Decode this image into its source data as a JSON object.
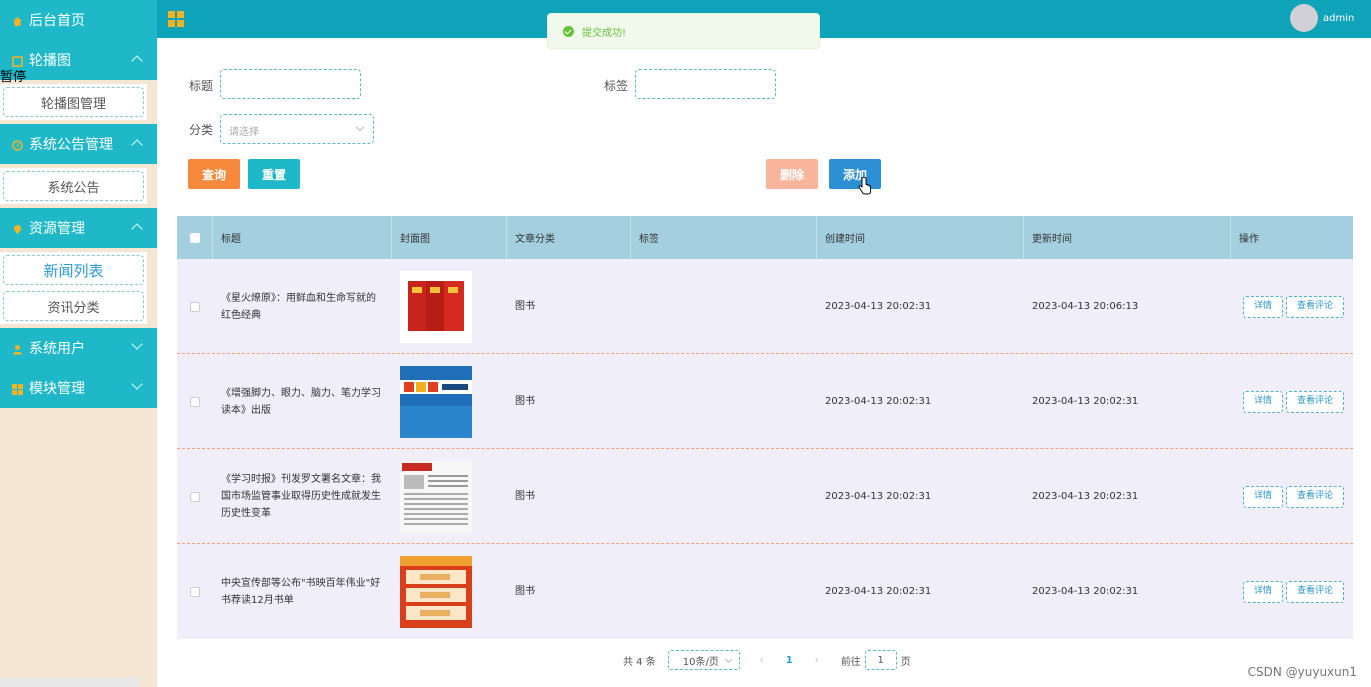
{
  "sidebar": {
    "home": "后台首页",
    "groups": [
      {
        "label": "轮播图",
        "items": [
          "轮播图管理"
        ]
      },
      {
        "label": "系统公告管理",
        "items": [
          "系统公告"
        ]
      },
      {
        "label": "资源管理",
        "items": [
          "新闻列表",
          "资讯分类"
        ]
      },
      {
        "label": "系统用户",
        "items": []
      },
      {
        "label": "模块管理",
        "items": []
      }
    ],
    "stray_text": "暂停",
    "accent": "#1fb8c9"
  },
  "topbar": {
    "user": "admin",
    "color": "#0fa3b9"
  },
  "toast": {
    "message": "提交成功!"
  },
  "search": {
    "title_label": "标题",
    "tag_label": "标签",
    "category_label": "分类",
    "category_placeholder": "请选择"
  },
  "buttons": {
    "query": "查询",
    "reset": "重置",
    "delete": "删除",
    "add": "添加"
  },
  "table": {
    "headers": [
      "标题",
      "封面图",
      "文章分类",
      "标签",
      "创建时间",
      "更新时间",
      "操作"
    ],
    "rows": [
      {
        "title": "《星火燎原》：用鲜血和生命写就的红色经典",
        "category": "图书",
        "tag": "",
        "created": "2023-04-13 20:02:31",
        "updated": "2023-04-13 20:06:13"
      },
      {
        "title": "《增强脚力、眼力、脑力、笔力学习读本》出版",
        "category": "图书",
        "tag": "",
        "created": "2023-04-13 20:02:31",
        "updated": "2023-04-13 20:02:31"
      },
      {
        "title": "《学习时报》刊发罗文署名文章：我国市场监管事业取得历史性成就发生历史性变革",
        "category": "图书",
        "tag": "",
        "created": "2023-04-13 20:02:31",
        "updated": "2023-04-13 20:02:31"
      },
      {
        "title": "中央宣传部等公布\"书映百年伟业\"好书荐读12月书单",
        "category": "图书",
        "tag": "",
        "created": "2023-04-13 20:02:31",
        "updated": "2023-04-13 20:02:31"
      }
    ],
    "detail_label": "详情",
    "comment_label": "查看评论"
  },
  "pagination": {
    "total": "共 4 条",
    "page_size": "10条/页",
    "current": "1",
    "goto_prefix": "前往",
    "goto_value": "1",
    "goto_suffix": "页"
  },
  "watermark": "CSDN @yuyuxun1"
}
